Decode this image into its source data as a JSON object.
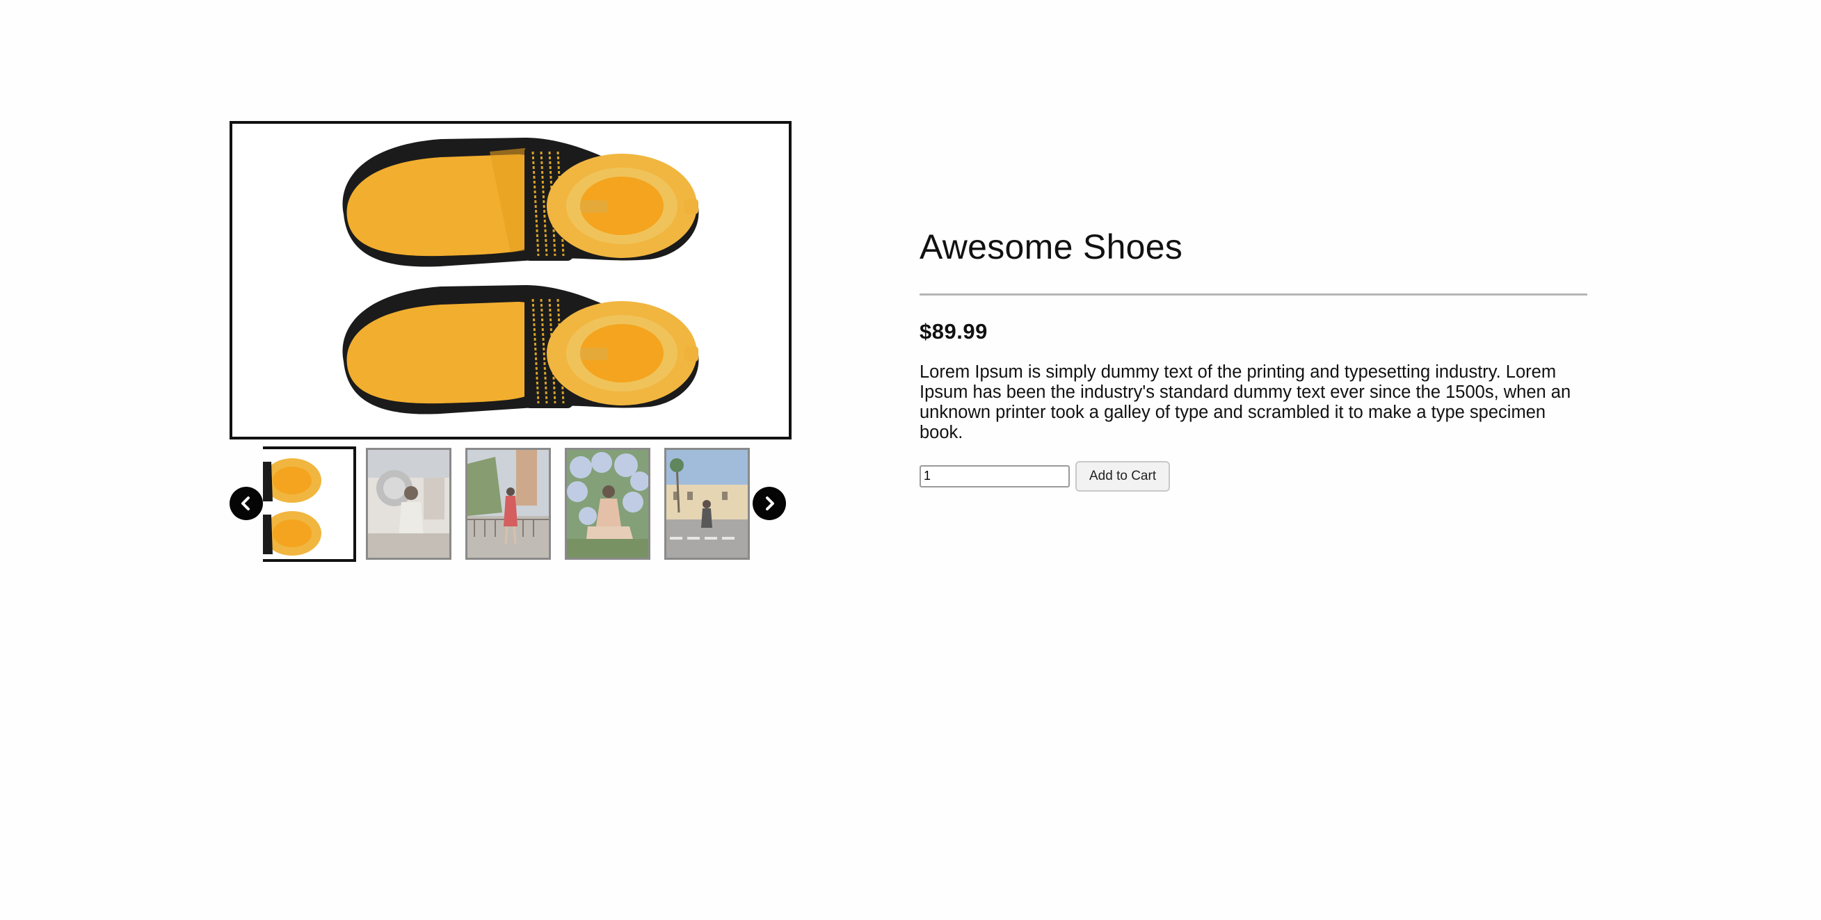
{
  "product": {
    "title": "Awesome Shoes",
    "price": "$89.99",
    "description": "Lorem Ipsum is simply dummy text of the printing and typesetting industry. Lorem Ipsum has been the industry's standard dummy text ever since the 1500s, when an unknown printer took a galley of type and scrambled it to make a type specimen book."
  },
  "cart": {
    "quantity": "1",
    "add_label": "Add to Cart"
  },
  "gallery": {
    "active_index": 0,
    "thumbnail_count": 5,
    "prev_icon": "chevron-left-icon",
    "next_icon": "chevron-right-icon"
  },
  "colors": {
    "shoe_yellow": "#f2ae2e",
    "shoe_black": "#1b1b1b",
    "arrow_bg": "#050505",
    "divider": "#b5b5b5"
  }
}
